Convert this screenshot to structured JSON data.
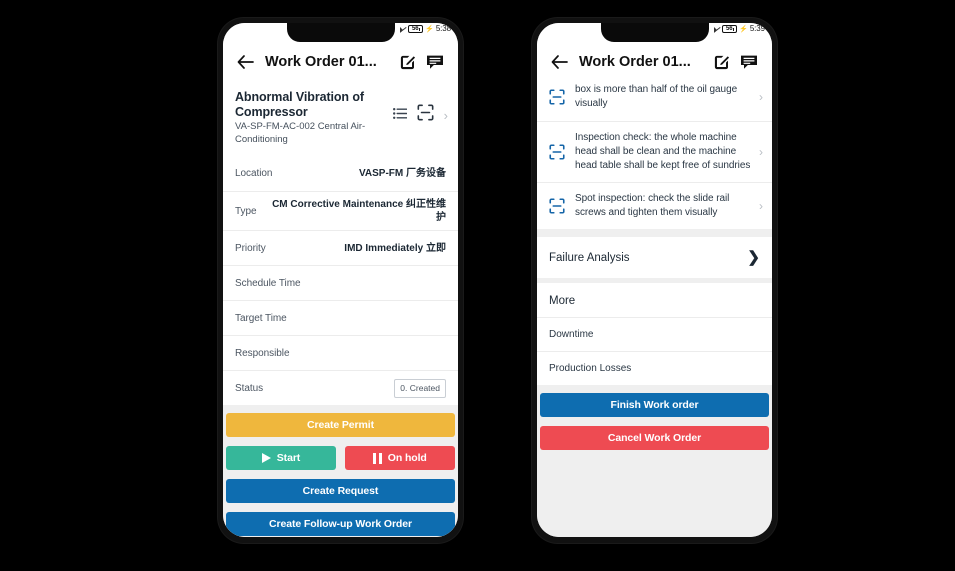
{
  "phones": [
    {
      "id": "left",
      "status": {
        "battery": "56",
        "clock": "5:38",
        "charging_glyph": "⚡",
        "mute_icon": "mute-icon"
      },
      "appbar": {
        "back_icon": "back-arrow-icon",
        "title": "Work Order 01...",
        "edit_icon": "edit-icon",
        "comment_icon": "comment-icon"
      },
      "title_card": {
        "name": "Abnormal Vibration of Compressor",
        "subtitle": "VA-SP-FM-AC-002 Central Air-Conditioning",
        "list_icon": "list-icon",
        "scan_icon": "scan-icon",
        "chevron": "›"
      },
      "fields": [
        {
          "key": "Location",
          "value": "VASP-FM 厂务设备",
          "type": "text"
        },
        {
          "key": "Type",
          "value": "CM Corrective Maintenance 纠正性维护",
          "type": "text"
        },
        {
          "key": "Priority",
          "value": "IMD Immediately 立即",
          "type": "text"
        },
        {
          "key": "Schedule Time",
          "value": "",
          "type": "text"
        },
        {
          "key": "Target Time",
          "value": "",
          "type": "text"
        },
        {
          "key": "Responsible",
          "value": "",
          "type": "text"
        },
        {
          "key": "Status",
          "value": "0. Created",
          "type": "badge"
        }
      ],
      "buttons": {
        "create_permit": {
          "label": "Create Permit",
          "color": "#EFB73D"
        },
        "start": {
          "label": "Start",
          "color": "#36B79A",
          "icon": "play-icon"
        },
        "on_hold": {
          "label": "On hold",
          "color": "#EE4B52",
          "icon": "pause-icon"
        },
        "create_request": {
          "label": "Create Request",
          "color": "#0E6DB0"
        },
        "create_followup": {
          "label": "Create Follow-up Work Order",
          "color": "#0E6DB0"
        }
      }
    },
    {
      "id": "right",
      "status": {
        "battery": "56",
        "clock": "5:39",
        "charging_glyph": "⚡",
        "mute_icon": "mute-icon"
      },
      "appbar": {
        "back_icon": "back-arrow-icon",
        "title": "Work Order 01...",
        "edit_icon": "edit-icon",
        "comment_icon": "comment-icon"
      },
      "checklist": [
        {
          "text": "box is more than half of the oil gauge visually",
          "scan_icon": "scan-icon",
          "chevron": "›",
          "clipped": true
        },
        {
          "text": "Inspection check: the whole machine head shall be clean and the machine head table shall be kept free of sundries",
          "scan_icon": "scan-icon",
          "chevron": "›",
          "clipped": false
        },
        {
          "text": "Spot inspection: check the slide rail screws and tighten them visually",
          "scan_icon": "scan-icon",
          "chevron": "›",
          "clipped": false
        }
      ],
      "failure_analysis": {
        "label": "Failure Analysis",
        "chevron": "❯"
      },
      "more": {
        "heading": "More",
        "items": [
          {
            "label": "Downtime"
          },
          {
            "label": "Production Losses"
          }
        ]
      },
      "buttons": {
        "finish": {
          "label": "Finish Work order",
          "color": "#0E6DB0"
        },
        "cancel": {
          "label": "Cancel Work Order",
          "color": "#EE4B52"
        }
      }
    }
  ],
  "colors": {
    "amber": "#EFB73D",
    "teal": "#36B79A",
    "red": "#EE4B52",
    "blue": "#0E6DB0",
    "scan_blue": "#1565A8",
    "background": "#000000",
    "screen_bg": "#EFEFEF"
  }
}
